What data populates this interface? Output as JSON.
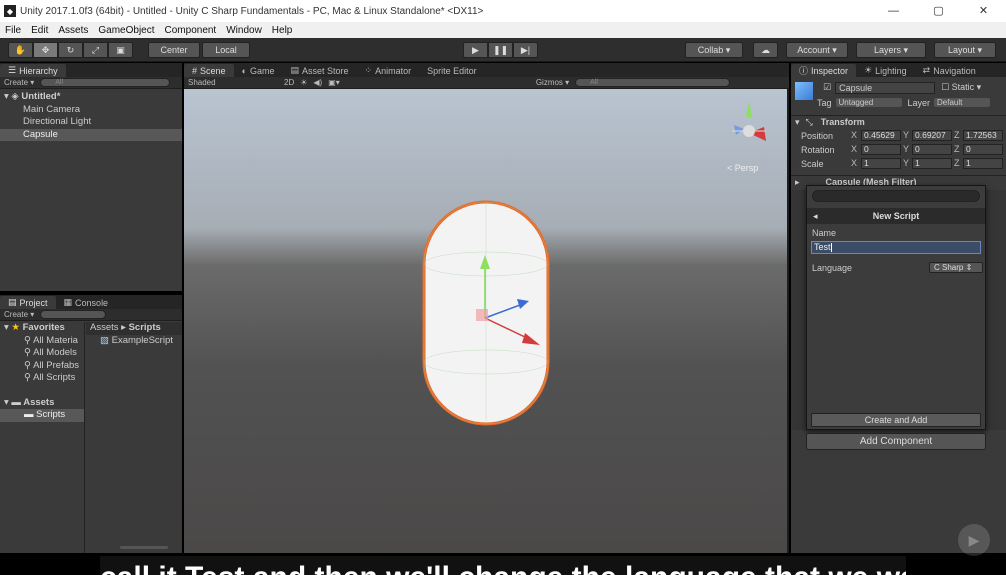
{
  "window": {
    "title": "Unity 2017.1.0f3 (64bit) - Untitled - Unity C Sharp Fundamentals - PC, Mac & Linux Standalone* <DX11>",
    "controls": [
      "—",
      "▢",
      "✕"
    ]
  },
  "menu": [
    "File",
    "Edit",
    "Assets",
    "GameObject",
    "Component",
    "Window",
    "Help"
  ],
  "toolbar": {
    "pivot": "Center",
    "space": "Local",
    "collab": "Collab ▾",
    "account": "Account ▾",
    "layers": "Layers ▾",
    "layout": "Layout ▾"
  },
  "hierarchy": {
    "tab": "Hierarchy",
    "create": "Create ▾",
    "search_placeholder": "All",
    "scene": "Untitled*",
    "items": [
      "Main Camera",
      "Directional Light",
      "Capsule"
    ],
    "selected_index": 2
  },
  "project": {
    "tabs": [
      "Project",
      "Console"
    ],
    "create": "Create ▾",
    "favorites_label": "Favorites",
    "favorites": [
      "All Materia",
      "All Models",
      "All Prefabs",
      "All Scripts"
    ],
    "assets_label": "Assets",
    "folders": [
      "Scripts"
    ],
    "breadcrumb": [
      "Assets",
      "Scripts"
    ],
    "files": [
      "ExampleScript"
    ]
  },
  "scene": {
    "tabs": [
      "Scene",
      "Game",
      "Asset Store",
      "Animator",
      "Sprite Editor"
    ],
    "shading": "Shaded",
    "mode2d": "2D",
    "gizmos": "Gizmos ▾",
    "search_placeholder": "All",
    "persp": "Persp"
  },
  "inspector": {
    "tabs": [
      "Inspector",
      "Lighting",
      "Navigation"
    ],
    "object_name": "Capsule",
    "static_label": "Static",
    "tag_label": "Tag",
    "tag_value": "Untagged",
    "layer_label": "Layer",
    "layer_value": "Default",
    "transform_title": "Transform",
    "position_label": "Position",
    "rotation_label": "Rotation",
    "scale_label": "Scale",
    "position": {
      "x": "0.45629",
      "y": "0.69207",
      "z": "1.72563"
    },
    "rotation": {
      "x": "0",
      "y": "0",
      "z": "0"
    },
    "scale": {
      "x": "1",
      "y": "1",
      "z": "1"
    },
    "mesh_filter_title": "Capsule (Mesh Filter)",
    "add_component": "Add Component"
  },
  "new_script_popup": {
    "header": "New Script",
    "name_label": "Name",
    "name_value": "Test",
    "language_label": "Language",
    "language_value": "C Sharp",
    "create_button": "Create and Add"
  },
  "subtitle": "call it Test and then we'll change the language that we want"
}
